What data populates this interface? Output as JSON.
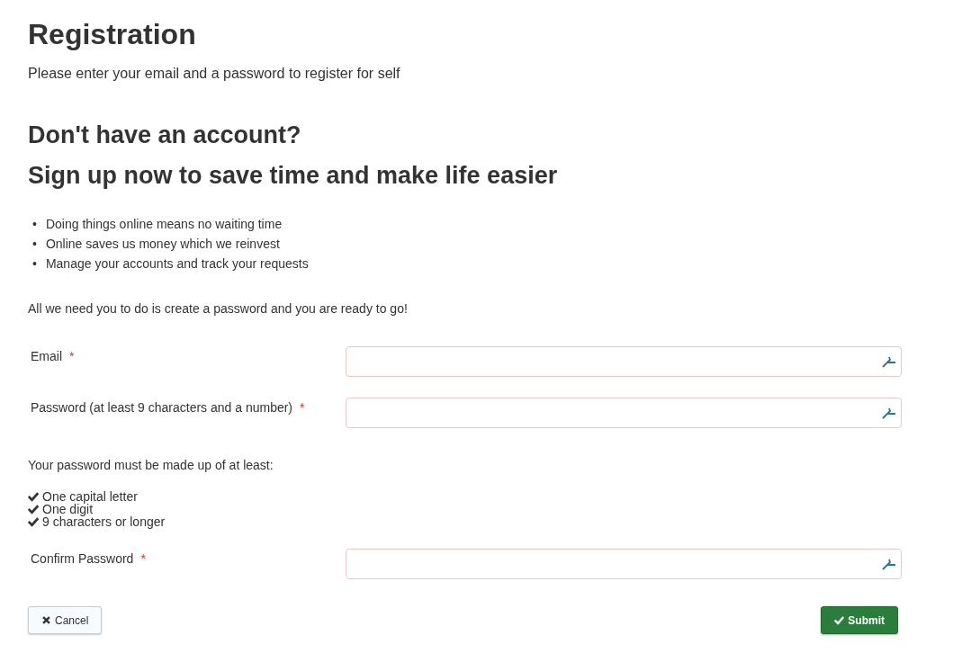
{
  "title": "Registration",
  "intro": "Please enter your email and a password to register for self",
  "headings": [
    "Don't have an account?",
    "Sign up now to save time and make life easier"
  ],
  "benefits": [
    {
      "marker": "•",
      "text": "Doing things online means no waiting time"
    },
    {
      "marker": "•",
      "text": "Online saves us money which we reinvest"
    },
    {
      "marker": "•",
      "text": "Manage your accounts and track your requests"
    }
  ],
  "note": "All we need you to do is create a password and you are ready to go!",
  "form": [
    {
      "kind": "field",
      "label": "Email",
      "required": true,
      "required_mark": "*"
    },
    {
      "kind": "field",
      "label": "Password (at least 9 characters and a number)",
      "required": true,
      "required_mark": "*"
    },
    {
      "kind": "rules",
      "intro": "Your password must be made up of at least:",
      "items": [
        {
          "text": "One capital letter",
          "checked": true
        },
        {
          "text": "One digit",
          "checked": true
        },
        {
          "text": "9 characters or longer",
          "checked": true
        }
      ]
    },
    {
      "kind": "field",
      "label": "Confirm Password",
      "required": true,
      "required_mark": "*"
    }
  ],
  "buttons": [
    {
      "kind": "cancel",
      "label": "Cancel"
    },
    {
      "kind": "submit",
      "label": "Submit"
    }
  ]
}
